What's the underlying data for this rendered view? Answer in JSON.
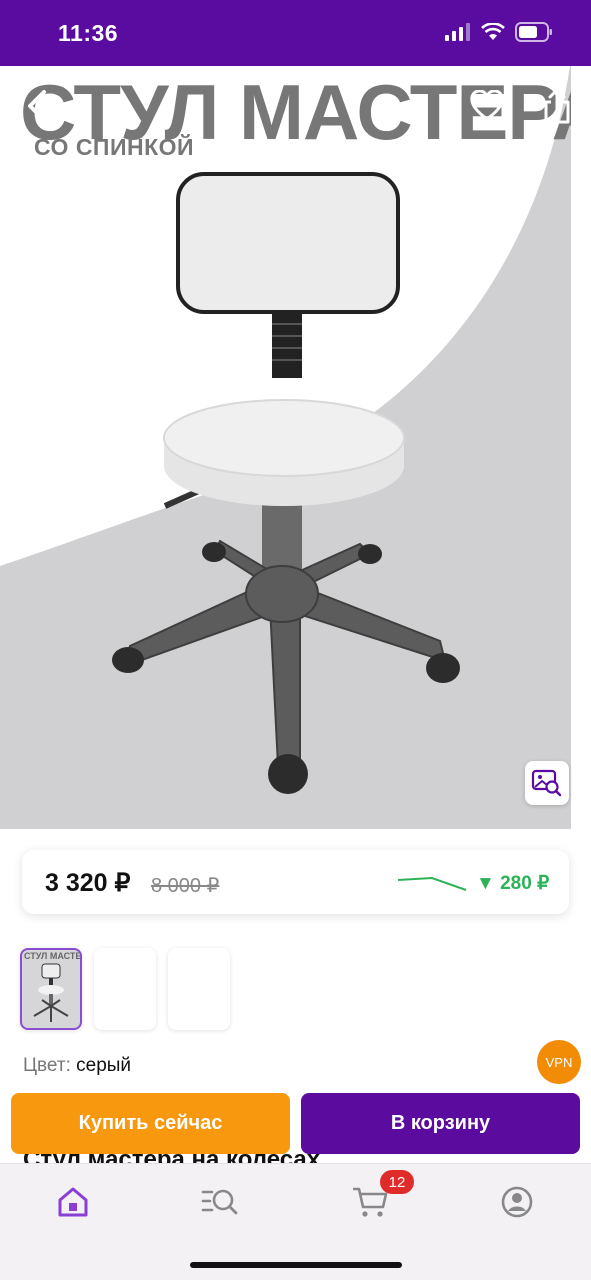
{
  "status_bar": {
    "time": "11:36"
  },
  "hero": {
    "title": "СТУЛ МАСТЕРА",
    "subtitle": "СО СПИНКОЙ"
  },
  "price": {
    "current": "3 320 ₽",
    "old": "8 000 ₽",
    "drop": "▼ 280 ₽"
  },
  "thumbnails": {
    "active_caption": "СТУЛ МАСТЕРА"
  },
  "color": {
    "label": "Цвет:",
    "value": "серый"
  },
  "vpn_badge": "VPN",
  "actions": {
    "buy_now": "Купить сейчас",
    "add_to_cart": "В корзину"
  },
  "product": {
    "name": "Стул мастера на колесах"
  },
  "bottom_nav": {
    "cart_count": "12"
  },
  "colors": {
    "brand_purple": "#5a0ca1",
    "buy_orange": "#f7980f",
    "price_drop_green": "#2cb257",
    "badge_red": "#e02b2b"
  }
}
